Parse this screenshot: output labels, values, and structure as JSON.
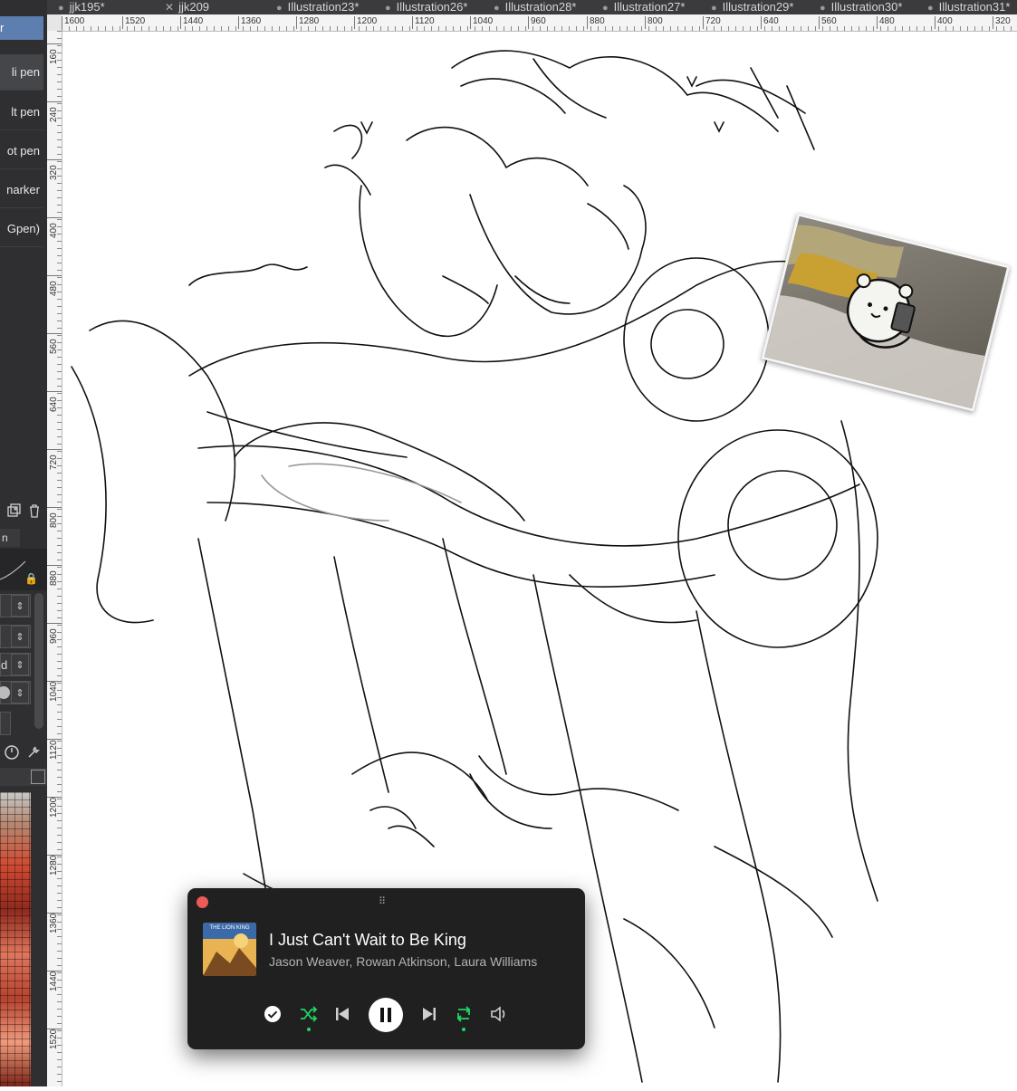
{
  "tabs": [
    {
      "label": "jjk195*",
      "mark": "dot"
    },
    {
      "label": "jjk209",
      "mark": "close"
    },
    {
      "label": "Illustration23*",
      "mark": "dot"
    },
    {
      "label": "Illustration26*",
      "mark": "dot"
    },
    {
      "label": "Illustration28*",
      "mark": "dot"
    },
    {
      "label": "Illustration27*",
      "mark": "dot"
    },
    {
      "label": "Illustration29*",
      "mark": "dot"
    },
    {
      "label": "Illustration30*",
      "mark": "dot"
    },
    {
      "label": "Illustration31*",
      "mark": "dot"
    }
  ],
  "ruler": {
    "horizontal": [
      "1600",
      "1520",
      "1440",
      "1360",
      "1280",
      "1200",
      "1120",
      "1040",
      "960",
      "880",
      "800",
      "720",
      "640",
      "560",
      "480",
      "400",
      "320"
    ],
    "vertical": [
      "160",
      "240",
      "320",
      "400",
      "480",
      "560",
      "640",
      "720",
      "800",
      "880",
      "960",
      "1040",
      "1120",
      "1200",
      "1280",
      "1360",
      "1440",
      "1520"
    ]
  },
  "tool_panel": {
    "selected_group": "r",
    "brushes": [
      "li pen",
      "lt pen",
      "ot pen",
      "narker",
      "Gpen)"
    ],
    "active_brush_index": 0,
    "tab_label": "n",
    "controls": [
      "",
      "",
      "d",
      "",
      ""
    ],
    "icons": [
      "duplicate-layer-icon",
      "delete-icon",
      "lock-icon",
      "wrench-icon",
      "palette-grid-icon"
    ]
  },
  "player": {
    "title": "I Just Can't Wait to Be King",
    "artists": "Jason Weaver, Rowan Atkinson, Laura Williams",
    "album_art_label": "THE LION KING",
    "grip": "⠿",
    "shuffle_active": true,
    "repeat_active": true,
    "is_playing": true,
    "accent_color": "#1ed760",
    "controls": [
      "saved-check-icon",
      "shuffle-icon",
      "previous-icon",
      "pause-icon",
      "next-icon",
      "repeat-icon",
      "volume-icon"
    ]
  },
  "reference_image": {
    "subject": "white bear character holding a phone in bed"
  }
}
